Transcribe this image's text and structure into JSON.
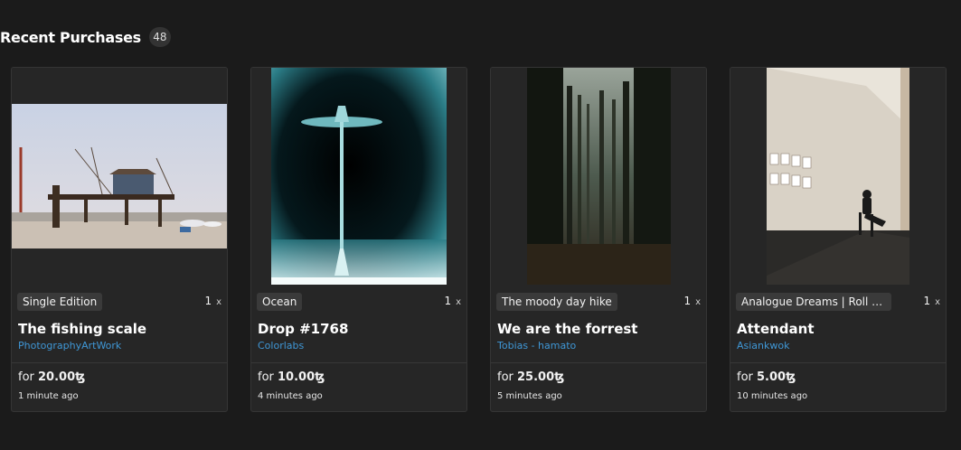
{
  "header": {
    "title": "Recent Purchases",
    "count": "48"
  },
  "purchases": [
    {
      "tag": "Single Edition",
      "quantity": "1",
      "quantity_suffix": "x",
      "title": "The fishing scale",
      "creator": "PhotographyArtWork",
      "price_prefix": "for",
      "price": "20.00",
      "currency": "ꜩ",
      "time": "1 minute ago"
    },
    {
      "tag": "Ocean",
      "quantity": "1",
      "quantity_suffix": "x",
      "title": "Drop #1768",
      "creator": "Colorlabs",
      "price_prefix": "for",
      "price": "10.00",
      "currency": "ꜩ",
      "time": "4 minutes ago"
    },
    {
      "tag": "The moody day hike",
      "quantity": "1",
      "quantity_suffix": "x",
      "title": "We are the forrest",
      "creator": "Tobias - hamato",
      "price_prefix": "for",
      "price": "25.00",
      "currency": "ꜩ",
      "time": "5 minutes ago"
    },
    {
      "tag": "Analogue Dreams | Roll Th…",
      "quantity": "1",
      "quantity_suffix": "x",
      "title": "Attendant",
      "creator": "Asiankwok",
      "price_prefix": "for",
      "price": "5.00",
      "currency": "ꜩ",
      "time": "10 minutes ago"
    }
  ]
}
